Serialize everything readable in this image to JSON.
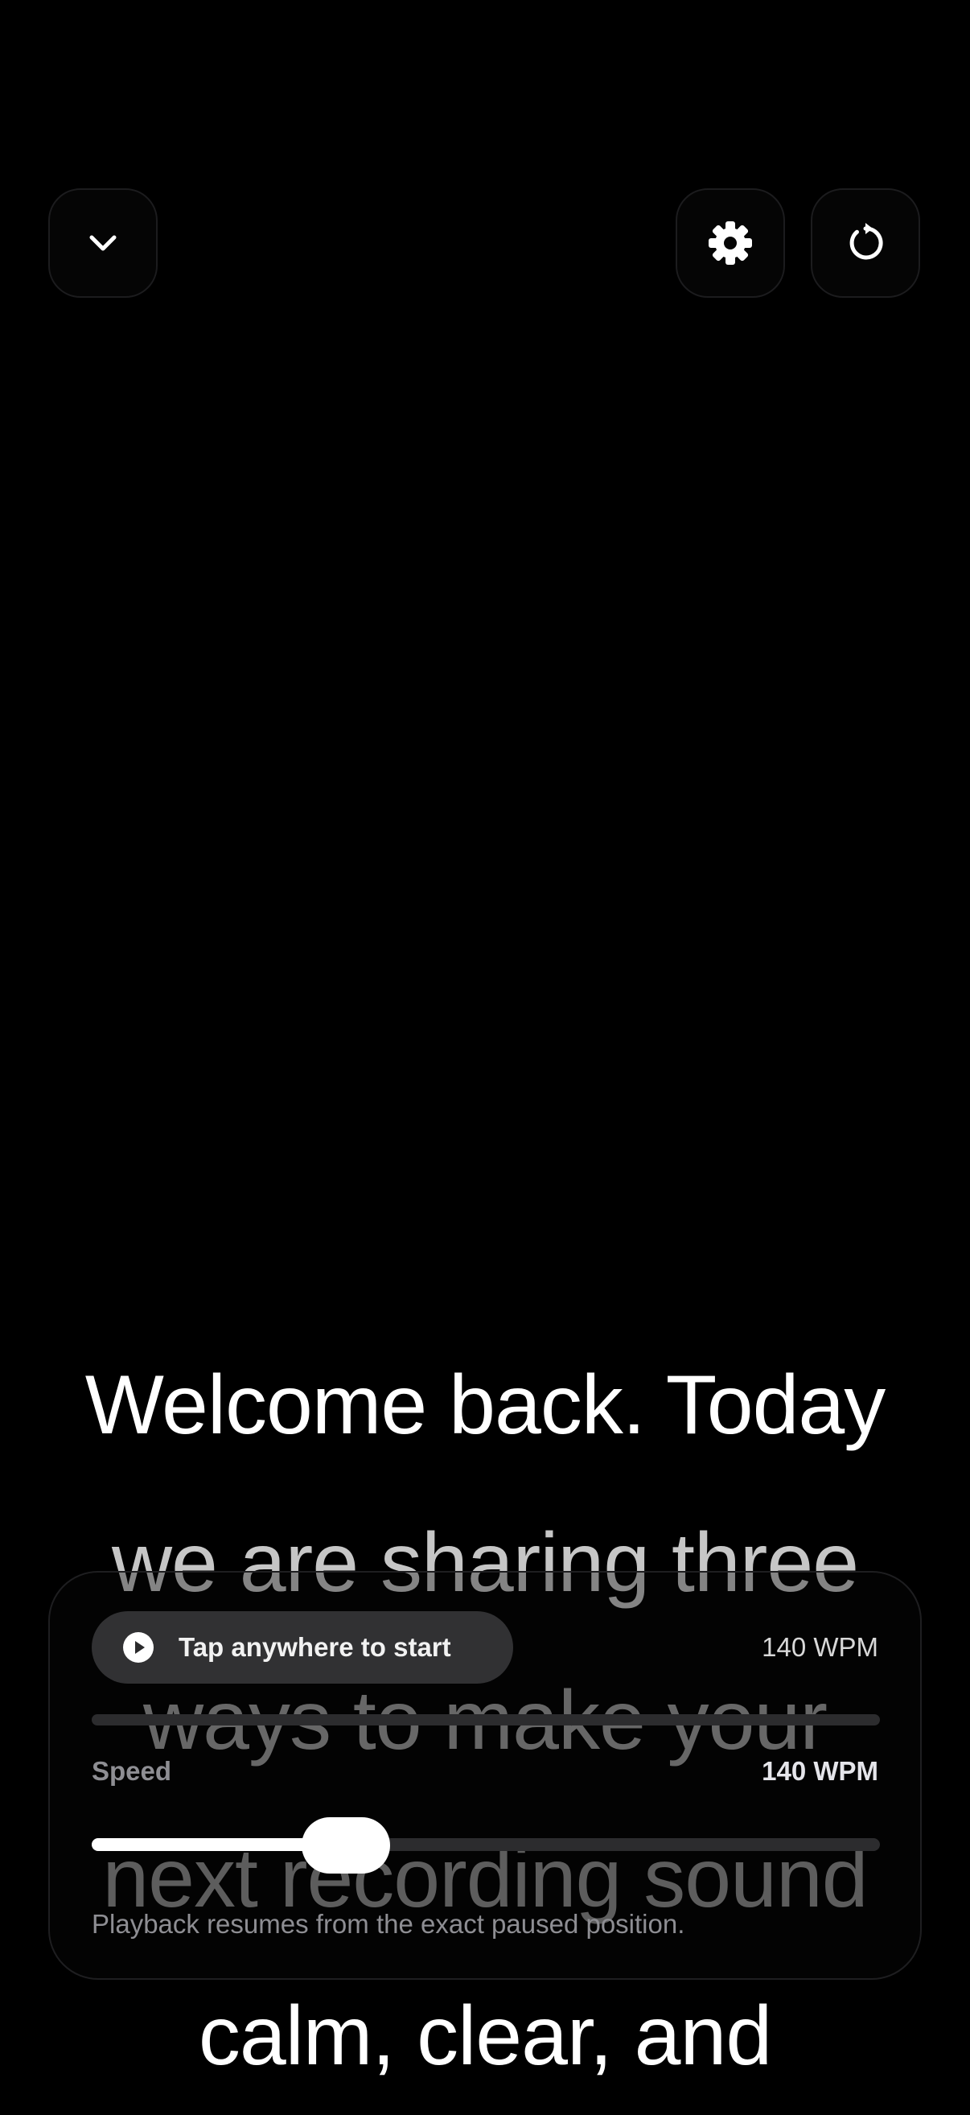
{
  "toolbar": {
    "collapse_icon": "chevron-down-icon",
    "settings_icon": "gear-icon",
    "restart_icon": "restart-icon"
  },
  "script": {
    "lines": [
      {
        "text": "Welcome back. Today",
        "color": "#ffffff"
      },
      {
        "text": "we are sharing three",
        "color": "#c6c6c6"
      },
      {
        "text": "ways to make your",
        "color": "#9a9a9a"
      },
      {
        "text": "next recording sound",
        "color": "#8a8a8a"
      },
      {
        "text": "calm, clear, and",
        "color": "#ffffff"
      }
    ]
  },
  "controls": {
    "start_label": "Tap anywhere to start",
    "wpm_display": "140 WPM",
    "progress": 0.0,
    "speed_label": "Speed",
    "speed_value": "140 WPM",
    "speed_fraction": 0.3,
    "hint": "Playback resumes from the exact paused position."
  },
  "colors": {
    "background": "#000000",
    "accent": "#ffffff",
    "muted": "#8e8e93"
  }
}
